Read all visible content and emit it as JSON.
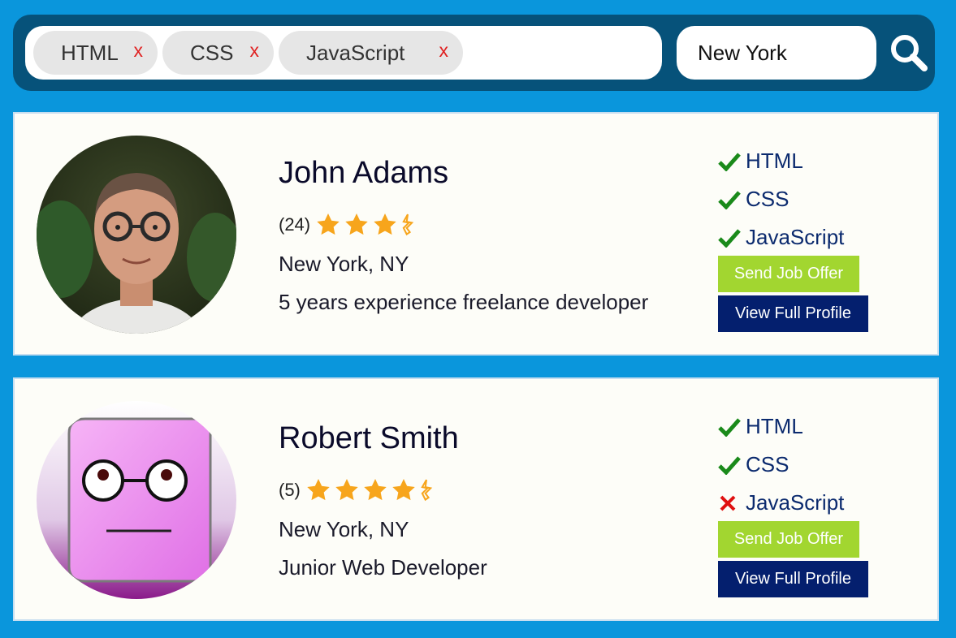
{
  "search": {
    "tags": [
      {
        "label": "HTML",
        "remove": "x"
      },
      {
        "label": "CSS",
        "remove": "x"
      },
      {
        "label": "JavaScript",
        "remove": "x"
      }
    ],
    "location_value": "New York",
    "search_icon": "search-icon"
  },
  "colors": {
    "background": "#0a96dc",
    "search_bar": "#06527a",
    "offer_button": "#a2d630",
    "profile_button": "#041f6e",
    "star": "#f7a51c",
    "check": "#1a8a1a",
    "cross": "#e01010"
  },
  "candidates": [
    {
      "name": "John Adams",
      "rating_count": "(24)",
      "rating_stars": 3.5,
      "location": "New York, NY",
      "description": "5 years experience freelance developer",
      "skills": [
        {
          "label": "HTML",
          "match": true
        },
        {
          "label": "CSS",
          "match": true
        },
        {
          "label": "JavaScript",
          "match": true
        }
      ],
      "offer_label": "Send Job Offer",
      "profile_label": "View Full Profile"
    },
    {
      "name": "Robert Smith",
      "rating_count": "(5)",
      "rating_stars": 4.5,
      "location": "New York, NY",
      "description": "Junior Web Developer",
      "skills": [
        {
          "label": "HTML",
          "match": true
        },
        {
          "label": "CSS",
          "match": true
        },
        {
          "label": "JavaScript",
          "match": false
        }
      ],
      "offer_label": "Send Job Offer",
      "profile_label": "View Full Profile"
    }
  ]
}
